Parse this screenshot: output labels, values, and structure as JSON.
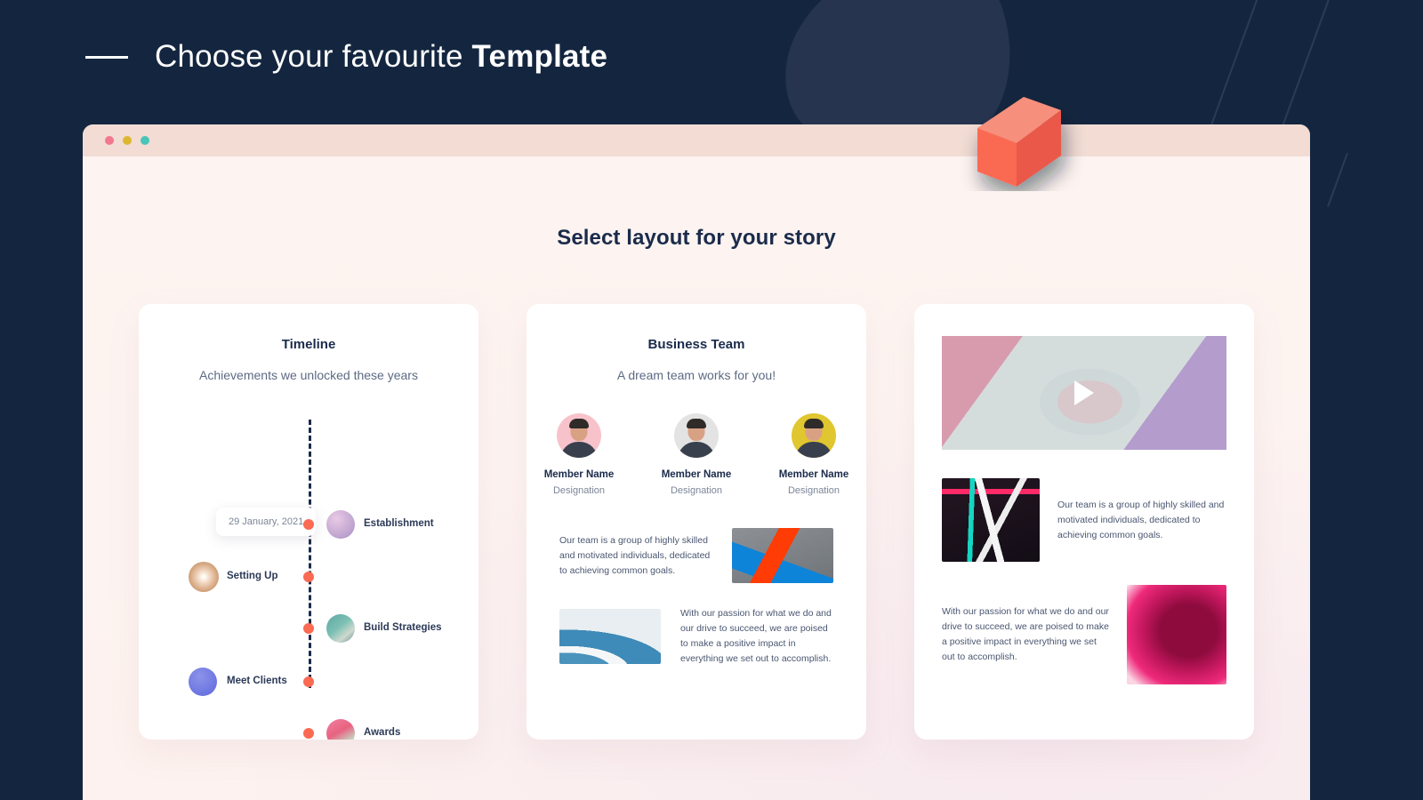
{
  "headline": {
    "light": "Choose your favourite ",
    "bold": "Template"
  },
  "browser": {
    "dots": [
      "close-dot",
      "minimize-dot",
      "maximize-dot"
    ],
    "section_title": "Select layout for your story"
  },
  "cards": {
    "timeline": {
      "title": "Timeline",
      "subtitle": "Achievements we unlocked these years",
      "date_chip": "29 January, 2021",
      "items": [
        {
          "label": "Establishment",
          "side": "right"
        },
        {
          "label": "Setting Up",
          "side": "left"
        },
        {
          "label": "Build Strategies",
          "side": "right"
        },
        {
          "label": "Meet Clients",
          "side": "left"
        },
        {
          "label": "Awards",
          "side": "right"
        }
      ]
    },
    "team": {
      "title": "Business Team",
      "subtitle": "A dream team works for you!",
      "members": [
        {
          "name": "Member Name",
          "designation": "Designation"
        },
        {
          "name": "Member Name",
          "designation": "Designation"
        },
        {
          "name": "Member Name",
          "designation": "Designation"
        }
      ],
      "blurb_1": "Our team is a group of highly skilled and motivated individuals, dedicated to achieving common goals.",
      "blurb_2": "With our passion for what we do and our drive to succeed, we are poised to make a positive impact in everything we set out to accomplish."
    },
    "media": {
      "blurb_1": "Our team is a group of highly skilled and motivated individuals, dedicated to achieving common goals.",
      "blurb_2": "With our passion for what we do and our drive to succeed, we are poised to make a positive impact in everything we set out to accomplish."
    }
  },
  "colors": {
    "background_navy": "#14263f",
    "accent_coral": "#fb6a52",
    "titlebar": "#f2dcd4",
    "card": "#ffffff",
    "text_dark": "#1b2b4b",
    "text_muted": "#7b8698"
  }
}
